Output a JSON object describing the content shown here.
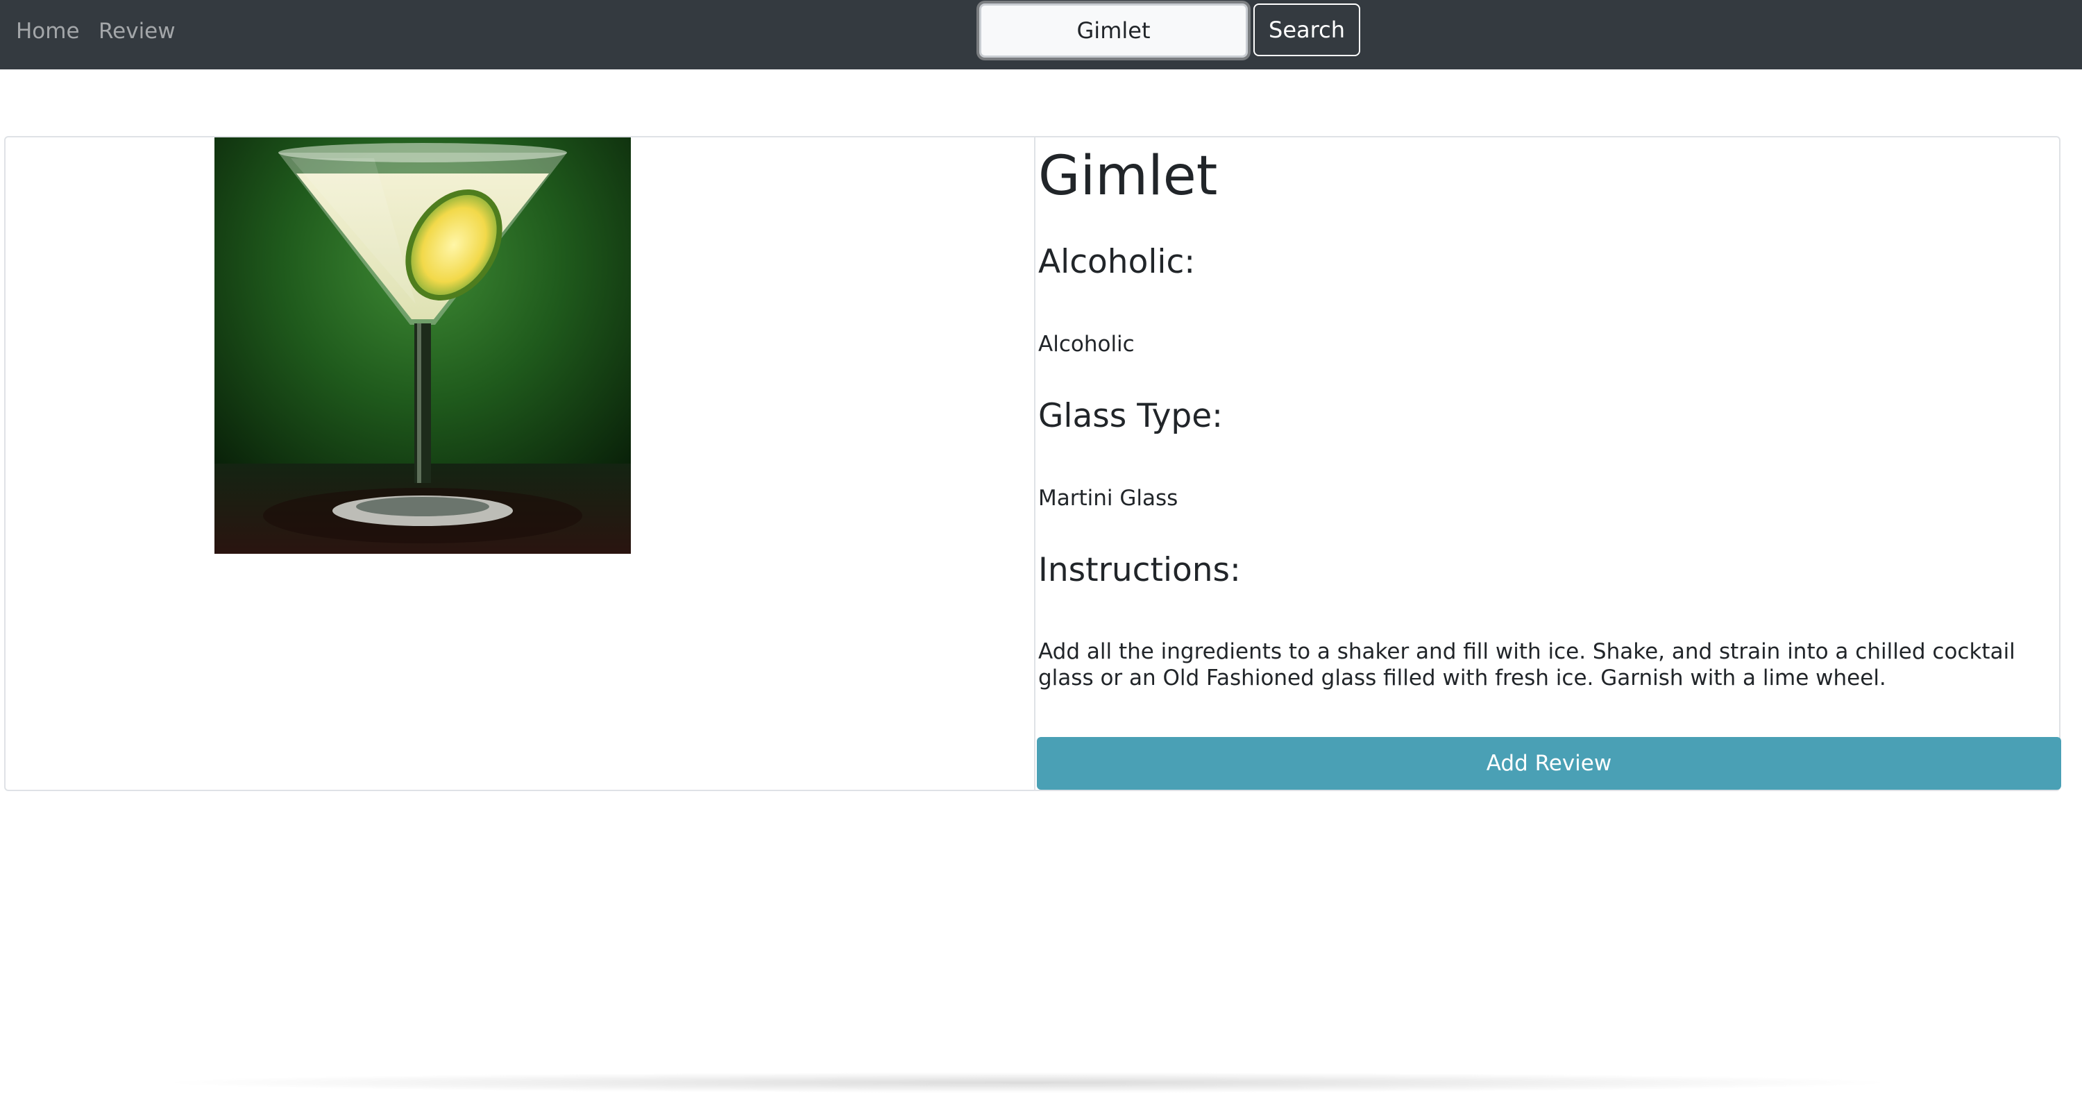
{
  "nav": {
    "home_label": "Home",
    "review_label": "Review"
  },
  "search": {
    "value": "Gimlet",
    "button_label": "Search"
  },
  "drink": {
    "image_icon": "cocktail-martini-glass-photo",
    "name": "Gimlet",
    "alcoholic_heading": "Alcoholic:",
    "alcoholic_value": "Alcoholic",
    "glass_heading": "Glass Type:",
    "glass_value": "Martini Glass",
    "instructions_heading": "Instructions:",
    "instructions_value": "Add all the ingredients to a shaker and fill with ice. Shake, and strain into a chilled cocktail glass or an Old Fashioned glass filled with fresh ice. Garnish with a lime wheel.",
    "add_review_label": "Add Review"
  },
  "colors": {
    "navbar": "#343a40",
    "accent_button": "#4aa0b5"
  }
}
